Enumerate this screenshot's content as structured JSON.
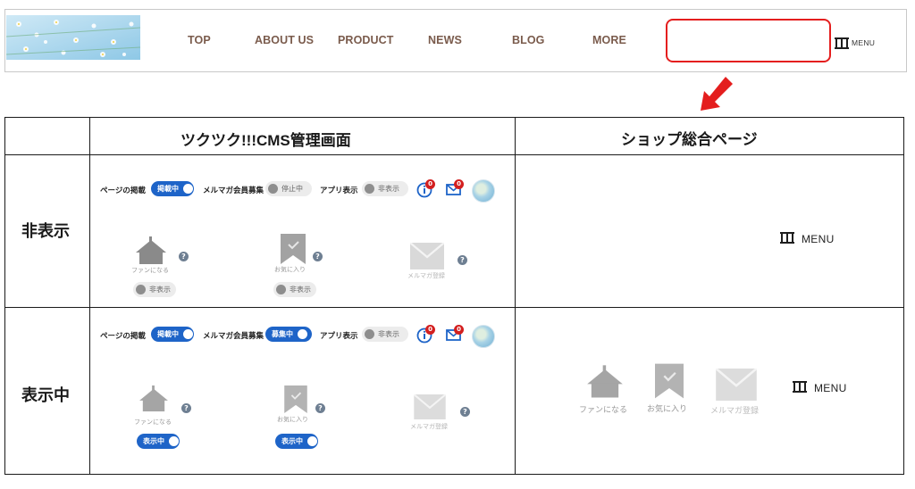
{
  "header": {
    "nav": [
      "TOP",
      "ABOUT US",
      "PRODUCT",
      "NEWS",
      "BLOG",
      "MORE"
    ],
    "menu_label": "MENU",
    "highlight_color": "#e41e1e",
    "nav_color": "#7a5b4c"
  },
  "table": {
    "col_cms": "ツクツク!!!CMS管理画面",
    "col_shop": "ショップ総合ページ",
    "row_hidden": "非表示",
    "row_shown": "表示中"
  },
  "cms_hidden": {
    "page_label": "ページの掲載",
    "page_toggle": "掲載中",
    "mail_label": "メルマガ会員募集",
    "mail_toggle": "停止中",
    "app_label": "アプリ表示",
    "app_toggle": "非表示",
    "info_badge": "0",
    "mail_badge": "0",
    "fan_caption": "ファンになる",
    "fav_caption": "お気に入り",
    "mail_caption": "メルマガ登録",
    "fan_toggle": "非表示",
    "fav_toggle": "非表示"
  },
  "cms_shown": {
    "page_label": "ページの掲載",
    "page_toggle": "掲載中",
    "mail_label": "メルマガ会員募集",
    "mail_toggle": "募集中",
    "app_label": "アプリ表示",
    "app_toggle": "非表示",
    "info_badge": "0",
    "mail_badge": "0",
    "fan_caption": "ファンになる",
    "fav_caption": "お気に入り",
    "mail_caption": "メルマガ登録",
    "fan_toggle": "表示中",
    "fav_toggle": "表示中"
  },
  "shop_hidden": {
    "menu_label": "MENU"
  },
  "shop_shown": {
    "fan_caption": "ファンになる",
    "fav_caption": "お気に入り",
    "mail_caption": "メルマガ登録",
    "menu_label": "MENU"
  },
  "colors": {
    "toggle_on": "#1e64c8",
    "badge": "#d31f1f",
    "icon_gray": "#8a8a8a"
  }
}
